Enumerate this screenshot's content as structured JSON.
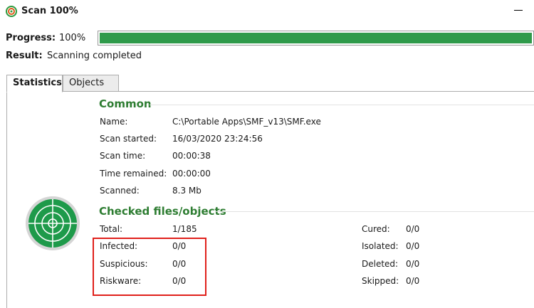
{
  "window": {
    "title": "Scan 100%"
  },
  "progress": {
    "label": "Progress:",
    "percent_text": "100%",
    "value": 100,
    "color": "#2f9a4a"
  },
  "result": {
    "label": "Result:",
    "text": "Scanning completed"
  },
  "tabs": [
    {
      "label": "Statistics",
      "active": true
    },
    {
      "label": "Objects",
      "active": false
    }
  ],
  "common": {
    "title": "Common",
    "rows": [
      {
        "label": "Name:",
        "value": "C:\\Portable Apps\\SMF_v13\\SMF.exe"
      },
      {
        "label": "Scan started:",
        "value": "16/03/2020 23:24:56"
      },
      {
        "label": "Scan time:",
        "value": "00:00:38"
      },
      {
        "label": "Time remained:",
        "value": "00:00:00"
      },
      {
        "label": "Scanned:",
        "value": "8.3 Mb"
      }
    ]
  },
  "checked": {
    "title": "Checked files/objects",
    "left": [
      {
        "label": "Total:",
        "value": "1/185"
      },
      {
        "label": "Infected:",
        "value": "0/0"
      },
      {
        "label": "Suspicious:",
        "value": "0/0"
      },
      {
        "label": "Riskware:",
        "value": "0/0"
      }
    ],
    "right": [
      {
        "label": "Cured:",
        "value": "0/0"
      },
      {
        "label": "Isolated:",
        "value": "0/0"
      },
      {
        "label": "Deleted:",
        "value": "0/0"
      },
      {
        "label": "Skipped:",
        "value": "0/0"
      }
    ]
  },
  "colors": {
    "accent_green": "#2e7d32",
    "highlight_red": "#e0201b"
  },
  "icons": {
    "app": "target-icon",
    "radar": "radar-icon"
  }
}
